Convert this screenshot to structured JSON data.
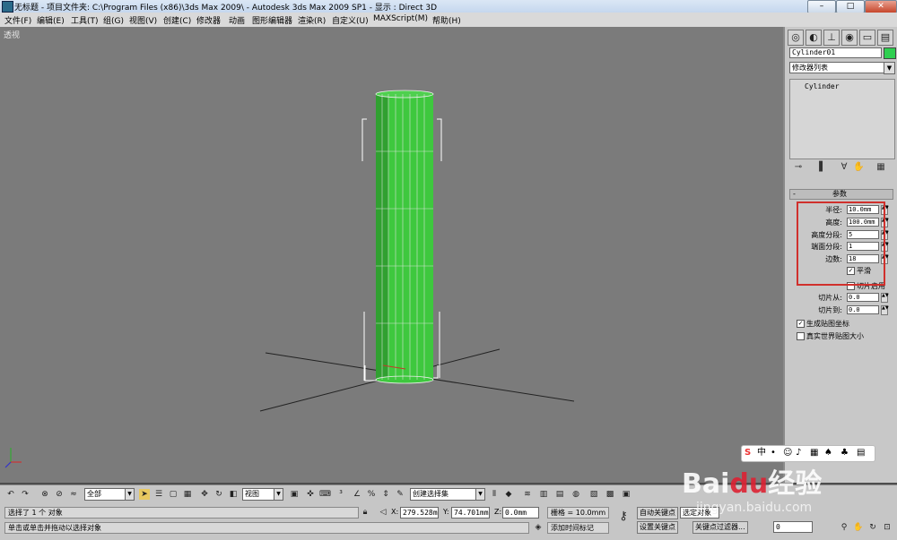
{
  "titlebar": {
    "title": "无标题  - 项目文件夹: C:\\Program Files (x86)\\3ds Max 2009\\    - Autodesk 3ds Max  2009 SP1    - 显示 : Direct 3D",
    "minimize": "–",
    "maximize": "□",
    "close": "✕"
  },
  "menu": [
    "文件(F)",
    "编辑(E)",
    "工具(T)",
    "组(G)",
    "视图(V)",
    "创建(C)",
    "修改器",
    "动画",
    "图形编辑器",
    "渲染(R)",
    "自定义(U)",
    "MAXScript(M)",
    "帮助(H)"
  ],
  "viewport": {
    "label": "透视",
    "object_color": "#3ec83e",
    "background": "#7b7b7b"
  },
  "command_panel": {
    "tabs_icons": [
      "create-icon",
      "modify-icon",
      "hierarchy-icon",
      "motion-icon",
      "display-icon",
      "utilities-icon"
    ],
    "object_name": "Cylinder01",
    "object_color": "#2fcf50",
    "modifier_list": "修改器列表",
    "stack_item": "Cylinder",
    "params_title": "参数",
    "params": [
      {
        "label": "半径:",
        "value": "10.0mm"
      },
      {
        "label": "高度:",
        "value": "100.0mm"
      },
      {
        "label": "高度分段:",
        "value": "5"
      },
      {
        "label": "端面分段:",
        "value": "1"
      },
      {
        "label": "边数:",
        "value": "18"
      }
    ],
    "smooth_label": "平滑",
    "smooth_checked": true,
    "slice_on_label": "切片启用",
    "slice_on_checked": false,
    "slice_from_label": "切片从:",
    "slice_from_value": "0.0",
    "slice_to_label": "切片到:",
    "slice_to_value": "0.0",
    "gen_map_label": "生成贴图坐标",
    "gen_map_checked": true,
    "real_world_label": "真实世界贴图大小",
    "real_world_checked": false,
    "highlight_color": "#d0302c"
  },
  "toolbar": {
    "selection_filter": "全部",
    "ref_coord": "视图",
    "named_selection": "创建选择集"
  },
  "status": {
    "selected_text": "选择了 1 个 对象",
    "prompt_text": "单击或单击并拖动以选择对象",
    "x_label": "X:",
    "x_value": "279.528mm",
    "y_label": "Y:",
    "y_value": "74.701mm",
    "z_label": "Z:",
    "z_value": "0.0mm",
    "grid_text": "栅格 = 10.0mm",
    "add_time_tag": "添加时间标记",
    "auto_key": "自动关键点",
    "set_key": "设置关键点",
    "selected_obj": "选定对象",
    "key_filters": "关键点过滤器...",
    "frame_value": "0"
  },
  "watermark": {
    "main_left": "Bai",
    "paw": "du",
    "main_right": "经验",
    "sub": "jingyan.baidu.com"
  }
}
